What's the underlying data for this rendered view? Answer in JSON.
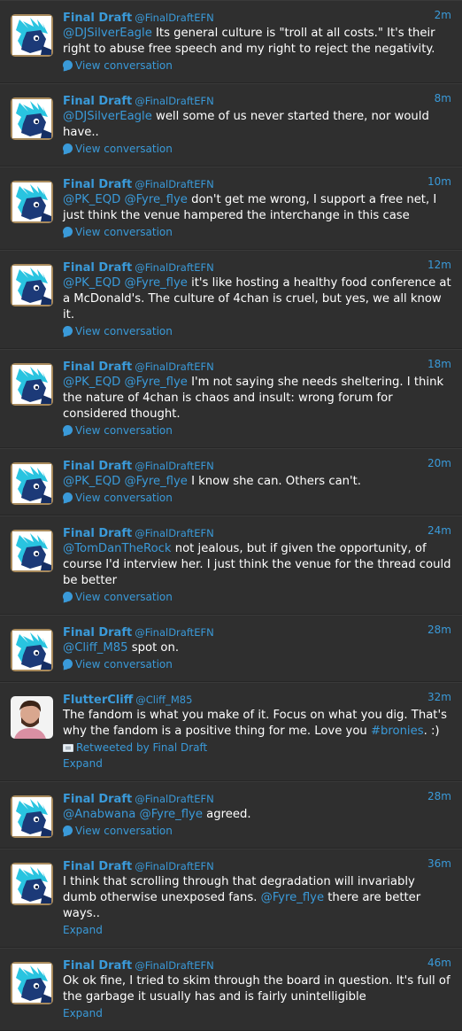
{
  "colors": {
    "background": "#2f2f2f",
    "link": "#3a9ad9",
    "text": "#ffffff"
  },
  "tweets": [
    {
      "name": "Final Draft",
      "handle": "@FinalDraftEFN",
      "time": "2m",
      "avatar": "pony",
      "segments": [
        {
          "t": "@DJSilverEagle",
          "m": true
        },
        {
          "t": "  Its general culture is \"troll at all costs.\" It's their right to abuse free speech and my right to reject the negativity."
        }
      ],
      "footer": {
        "type": "conversation",
        "label": "View conversation"
      }
    },
    {
      "name": "Final Draft",
      "handle": "@FinalDraftEFN",
      "time": "8m",
      "avatar": "pony",
      "segments": [
        {
          "t": "@DJSilverEagle",
          "m": true
        },
        {
          "t": " well some of us never started there, nor would have.."
        }
      ],
      "footer": {
        "type": "conversation",
        "label": "View conversation"
      }
    },
    {
      "name": "Final Draft",
      "handle": "@FinalDraftEFN",
      "time": "10m",
      "avatar": "pony",
      "segments": [
        {
          "t": "@PK_EQD",
          "m": true
        },
        {
          "t": " "
        },
        {
          "t": "@Fyre_flye",
          "m": true
        },
        {
          "t": " don't get me wrong, I support a free net, I just think the venue hampered the interchange in this case"
        }
      ],
      "footer": {
        "type": "conversation",
        "label": "View conversation"
      }
    },
    {
      "name": "Final Draft",
      "handle": "@FinalDraftEFN",
      "time": "12m",
      "avatar": "pony",
      "segments": [
        {
          "t": "@PK_EQD",
          "m": true
        },
        {
          "t": " "
        },
        {
          "t": "@Fyre_flye",
          "m": true
        },
        {
          "t": " it's like hosting a healthy food conference at a McDonald's. The culture of 4chan is cruel, but yes, we all know it."
        }
      ],
      "footer": {
        "type": "conversation",
        "label": "View conversation"
      }
    },
    {
      "name": "Final Draft",
      "handle": "@FinalDraftEFN",
      "time": "18m",
      "avatar": "pony",
      "segments": [
        {
          "t": "@PK_EQD",
          "m": true
        },
        {
          "t": " "
        },
        {
          "t": "@Fyre_flye",
          "m": true
        },
        {
          "t": " I'm not saying she needs sheltering. I think the nature of 4chan is chaos and insult: wrong forum for considered thought."
        }
      ],
      "footer": {
        "type": "conversation",
        "label": "View conversation"
      }
    },
    {
      "name": "Final Draft",
      "handle": "@FinalDraftEFN",
      "time": "20m",
      "avatar": "pony",
      "segments": [
        {
          "t": "@PK_EQD",
          "m": true
        },
        {
          "t": " "
        },
        {
          "t": "@Fyre_flye",
          "m": true
        },
        {
          "t": " I know she can. Others can't."
        }
      ],
      "footer": {
        "type": "conversation",
        "label": "View conversation"
      }
    },
    {
      "name": "Final Draft",
      "handle": "@FinalDraftEFN",
      "time": "24m",
      "avatar": "pony",
      "segments": [
        {
          "t": "@TomDanTheRock",
          "m": true
        },
        {
          "t": " not jealous, but if given the opportunity, of course I'd interview her. I just think the venue for the thread could be better"
        }
      ],
      "footer": {
        "type": "conversation",
        "label": "View conversation"
      }
    },
    {
      "name": "Final Draft",
      "handle": "@FinalDraftEFN",
      "time": "28m",
      "avatar": "pony",
      "segments": [
        {
          "t": "@Cliff_M85",
          "m": true
        },
        {
          "t": " spot on."
        }
      ],
      "footer": {
        "type": "conversation",
        "label": "View conversation"
      }
    },
    {
      "name": "FlutterCliff",
      "handle": "@Cliff_M85",
      "time": "32m",
      "avatar": "person",
      "segments": [
        {
          "t": "The fandom is what you make of it. Focus on what you dig. That's why the fandom is a positive thing for me. Love you "
        },
        {
          "t": "#bronies",
          "m": true
        },
        {
          "t": ". :)"
        }
      ],
      "retweet": "Retweeted by Final Draft",
      "footer": {
        "type": "expand",
        "label": "Expand"
      }
    },
    {
      "name": "Final Draft",
      "handle": "@FinalDraftEFN",
      "time": "28m",
      "avatar": "pony",
      "segments": [
        {
          "t": "@Anabwana",
          "m": true
        },
        {
          "t": " "
        },
        {
          "t": "@Fyre_flye",
          "m": true
        },
        {
          "t": " agreed."
        }
      ],
      "footer": {
        "type": "conversation",
        "label": "View conversation"
      }
    },
    {
      "name": "Final Draft",
      "handle": "@FinalDraftEFN",
      "time": "36m",
      "avatar": "pony",
      "segments": [
        {
          "t": "I think that scrolling through that degradation  will invariably dumb otherwise unexposed fans. "
        },
        {
          "t": "@Fyre_flye",
          "m": true
        },
        {
          "t": " there are better ways.."
        }
      ],
      "footer": {
        "type": "expand",
        "label": "Expand"
      }
    },
    {
      "name": "Final Draft",
      "handle": "@FinalDraftEFN",
      "time": "46m",
      "avatar": "pony",
      "segments": [
        {
          "t": "Ok ok fine, I tried to skim through the board in question. It's full of the garbage it usually has and is fairly unintelligible"
        }
      ],
      "footer": {
        "type": "expand",
        "label": "Expand"
      }
    }
  ]
}
